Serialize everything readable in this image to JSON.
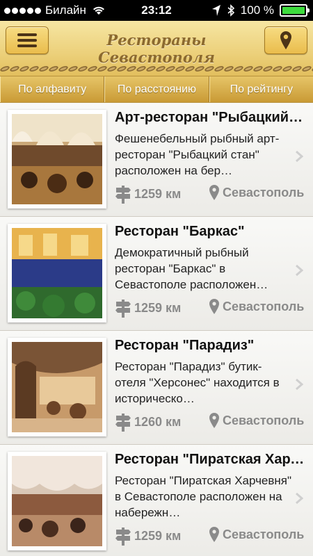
{
  "status": {
    "carrier": "Билайн",
    "time": "23:12",
    "battery_text": "100 %",
    "battery_level": 1.0
  },
  "header": {
    "title": "Рестораны Севастополя",
    "menu_icon": "hamburger-icon",
    "map_icon": "location-pin-icon"
  },
  "sort_tabs": [
    {
      "label": "По алфавиту"
    },
    {
      "label": "По расстоянию"
    },
    {
      "label": "По рейтингу"
    }
  ],
  "restaurants": [
    {
      "name": "Арт-ресторан \"Рыбацкий стан\"",
      "description": "Фешенебельный рыбный арт-ресторан \"Рыбацкий стан\" расположен на бер…",
      "distance": "1259 км",
      "city": "Севастополь"
    },
    {
      "name": "Ресторан \"Баркас\"",
      "description": "Демократичный рыбный ресторан \"Баркас\" в Севастополе расположен…",
      "distance": "1259 км",
      "city": "Севастополь"
    },
    {
      "name": "Ресторан \"Парадиз\"",
      "description": "Ресторан \"Парадиз\" бутик-отеля \"Херсонес\" находится в историческо…",
      "distance": "1260 км",
      "city": "Севастополь"
    },
    {
      "name": "Ресторан \"Пиратская Харчевня\"",
      "description": "Ресторан \"Пиратская Харчевня\" в Севастополе расположен на набережн…",
      "distance": "1259 км",
      "city": "Севастополь"
    }
  ],
  "colors": {
    "header_gold": "#ecd07a",
    "tab_gold": "#c99a35",
    "title_brown": "#8c6a2e",
    "meta_gray": "#8a8a8a"
  }
}
